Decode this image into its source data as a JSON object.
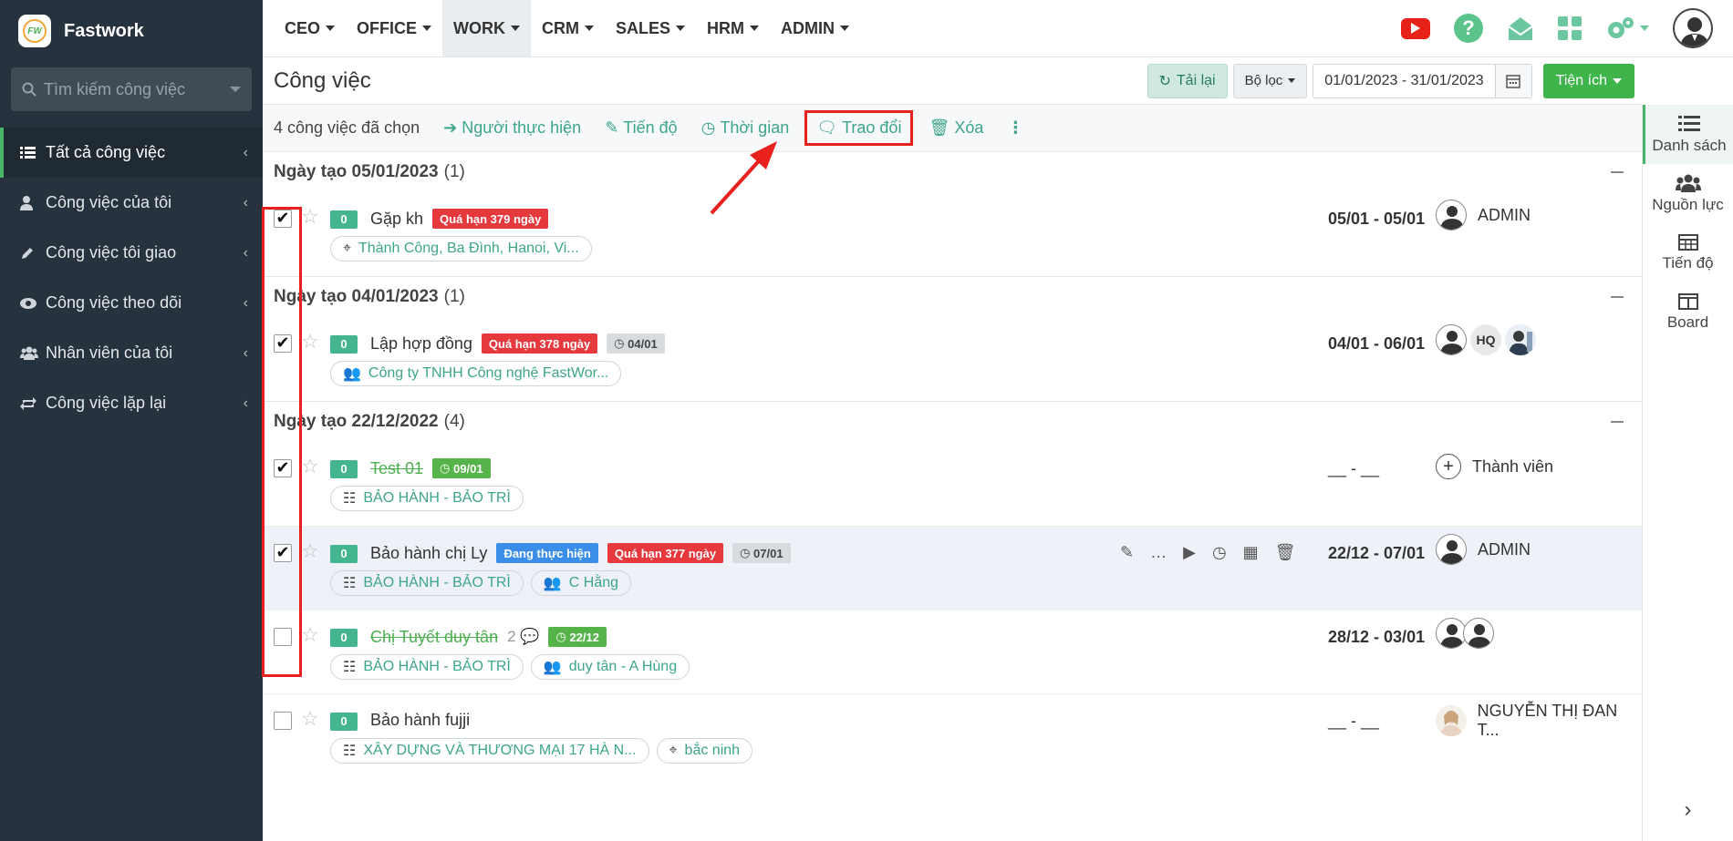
{
  "app": {
    "brand": "Fastwork",
    "logo_text": "FW"
  },
  "sidebar": {
    "search_placeholder": "Tìm kiếm công việc",
    "items": [
      {
        "label": "Tất cả công việc",
        "icon": "list-icon",
        "active": true
      },
      {
        "label": "Công việc của tôi",
        "icon": "user-icon"
      },
      {
        "label": "Công việc tôi giao",
        "icon": "pencil-icon"
      },
      {
        "label": "Công việc theo dõi",
        "icon": "eye-icon"
      },
      {
        "label": "Nhân viên của tôi",
        "icon": "users-icon"
      },
      {
        "label": "Công việc lặp lại",
        "icon": "repeat-icon"
      }
    ]
  },
  "topnav": {
    "menus": [
      "CEO",
      "OFFICE",
      "WORK",
      "CRM",
      "SALES",
      "HRM",
      "ADMIN"
    ],
    "active": "WORK"
  },
  "header": {
    "title": "Công việc",
    "reload": "Tải lại",
    "filter": "Bộ lọc",
    "date_range": "01/01/2023 - 31/01/2023",
    "utilities": "Tiện ích"
  },
  "selection_bar": {
    "count": "4 công việc đã chọn",
    "assignee": "Người thực hiện",
    "progress": "Tiến độ",
    "time": "Thời gian",
    "discuss": "Trao đổi",
    "delete": "Xóa"
  },
  "views": [
    {
      "label": "Danh sách",
      "active": true
    },
    {
      "label": "Nguồn lực"
    },
    {
      "label": "Tiến độ"
    },
    {
      "label": "Board"
    }
  ],
  "groups": [
    {
      "title": "Ngày tạo 05/01/2023",
      "count": "(1)",
      "tasks": [
        {
          "checked": true,
          "score": "0",
          "name": "Gặp kh",
          "overdue": "Quá hạn 379 ngày",
          "chips": [
            {
              "icon": "location-icon",
              "text": "Thành Công, Ba Đình, Hanoi, Vi..."
            }
          ],
          "dates": "05/01 - 05/01",
          "user": "ADMIN"
        }
      ]
    },
    {
      "title": "Ngày tạo 04/01/2023",
      "count": "(1)",
      "tasks": [
        {
          "checked": true,
          "score": "0",
          "name": "Lập hợp đồng",
          "overdue": "Quá hạn 378 ngày",
          "deadline": "04/01",
          "chips": [
            {
              "icon": "users-icon",
              "text": "Công ty TNHH Công nghệ FastWor..."
            }
          ],
          "dates": "04/01 - 06/01",
          "user_initials": "HQ"
        }
      ]
    },
    {
      "title": "Ngày tạo 22/12/2022",
      "count": "(4)",
      "tasks": [
        {
          "checked": true,
          "score": "0",
          "name": "Test 01",
          "done": true,
          "deadline": "09/01",
          "chips": [
            {
              "icon": "org-icon",
              "text": "BẢO HÀNH - BẢO TRÌ"
            }
          ],
          "dates": "__ - __",
          "add_member": "Thành viên"
        },
        {
          "checked": true,
          "score": "0",
          "name": "Bảo hành chị Ly",
          "status": "Đang thực hiện",
          "overdue": "Quá hạn 377 ngày",
          "deadline": "07/01",
          "chips": [
            {
              "icon": "org-icon",
              "text": "BẢO HÀNH - BẢO TRÌ"
            },
            {
              "icon": "users-icon",
              "text": "C Hằng"
            }
          ],
          "dates": "22/12 - 07/01",
          "user": "ADMIN"
        },
        {
          "checked": false,
          "score": "0",
          "name": "Chị Tuyết duy tân",
          "done": true,
          "comments": "2",
          "deadline": "22/12",
          "chips": [
            {
              "icon": "org-icon",
              "text": "BẢO HÀNH - BẢO TRÌ"
            },
            {
              "icon": "users-icon",
              "text": "duy tân - A Hùng"
            }
          ],
          "dates": "28/12 - 03/01"
        },
        {
          "checked": false,
          "score": "0",
          "name": "Bảo hành fujji",
          "chips": [
            {
              "icon": "org-icon",
              "text": "XÂY DỰNG VÀ THƯƠNG MẠI 17 HÀ N..."
            },
            {
              "icon": "location-icon",
              "text": "bắc ninh"
            }
          ],
          "dates": "__ - __",
          "user": "NGUYỄN THỊ ĐAN T..."
        }
      ]
    }
  ],
  "colors": {
    "sidebar_bg": "#26323d",
    "accent_green": "#3fb44b",
    "teal_text": "#3da58a",
    "overdue_red": "#e5393e",
    "annotation_red": "#e8201e"
  }
}
